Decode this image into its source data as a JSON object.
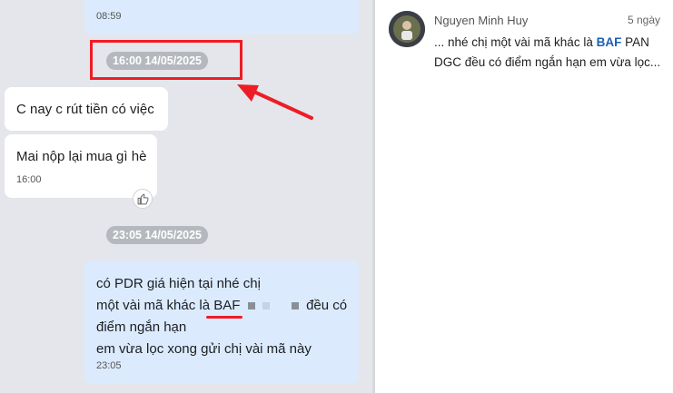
{
  "chat": {
    "msg_top_time": "08:59",
    "divider_1": "16:00 14/05/2025",
    "msg_in_1": "C nay c rút tiền có việc",
    "msg_in_2": "Mai nộp lại mua gì hè",
    "msg_in_2_time": "16:00",
    "divider_2": "23:05 14/05/2025",
    "msg_out": {
      "line1": "có PDR giá hiện tại nhé chị",
      "line2_pre": "một vài mã khác là ",
      "line2_code": "BAF",
      "line2_post": "đều có",
      "line3": "điểm ngắn hạn",
      "line4": "em vừa lọc xong gửi chị vài mã này",
      "time": "23:05"
    }
  },
  "conversation": {
    "name": "Nguyen Minh Huy",
    "time": "5 ngày",
    "preview_pre": "... nhé chị một vài mã khác là ",
    "preview_code": "BAF",
    "preview_post": " PAN DGC đều có điểm ngắn hạn em vừa lọc..."
  },
  "colors": {
    "annotation_red": "#ee1c25",
    "outgoing_bubble": "#dbeafd",
    "chat_background": "#e4e6eb"
  }
}
